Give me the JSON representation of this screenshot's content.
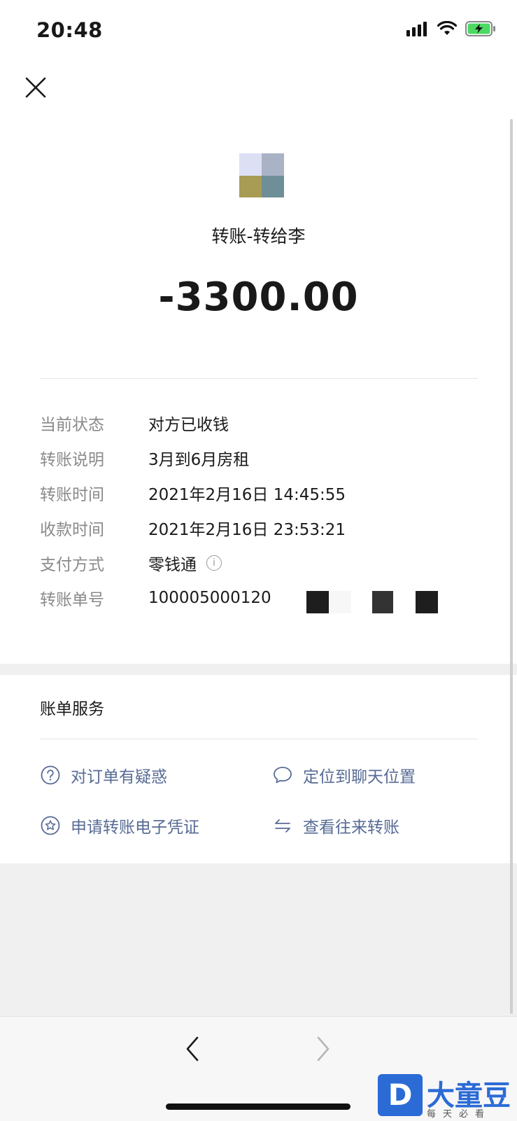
{
  "status_bar": {
    "time": "20:48"
  },
  "header": {
    "close_icon": "close-icon"
  },
  "payee": {
    "title": "转账-转给李"
  },
  "amount": "-3300.00",
  "details": [
    {
      "label": "当前状态",
      "value": "对方已收钱"
    },
    {
      "label": "转账说明",
      "value": "3月到6月房租"
    },
    {
      "label": "转账时间",
      "value": "2021年2月16日 14:45:55"
    },
    {
      "label": "收款时间",
      "value": "2021年2月16日 23:53:21"
    },
    {
      "label": "支付方式",
      "value": "零钱通"
    },
    {
      "label": "转账单号",
      "value": "100005000120"
    }
  ],
  "services": {
    "title": "账单服务",
    "items": [
      {
        "label": "对订单有疑惑",
        "icon": "question-icon"
      },
      {
        "label": "定位到聊天位置",
        "icon": "chat-bubble-icon"
      },
      {
        "label": "申请转账电子凭证",
        "icon": "star-badge-icon"
      },
      {
        "label": "查看往来转账",
        "icon": "transfer-arrows-icon"
      }
    ]
  },
  "colors": {
    "link": "#576b95",
    "muted": "#8a8a8a",
    "band": "#f0f0f0",
    "battery": "#4cd964"
  },
  "watermark": {
    "text": "大童豆",
    "sub": "每天必看"
  }
}
